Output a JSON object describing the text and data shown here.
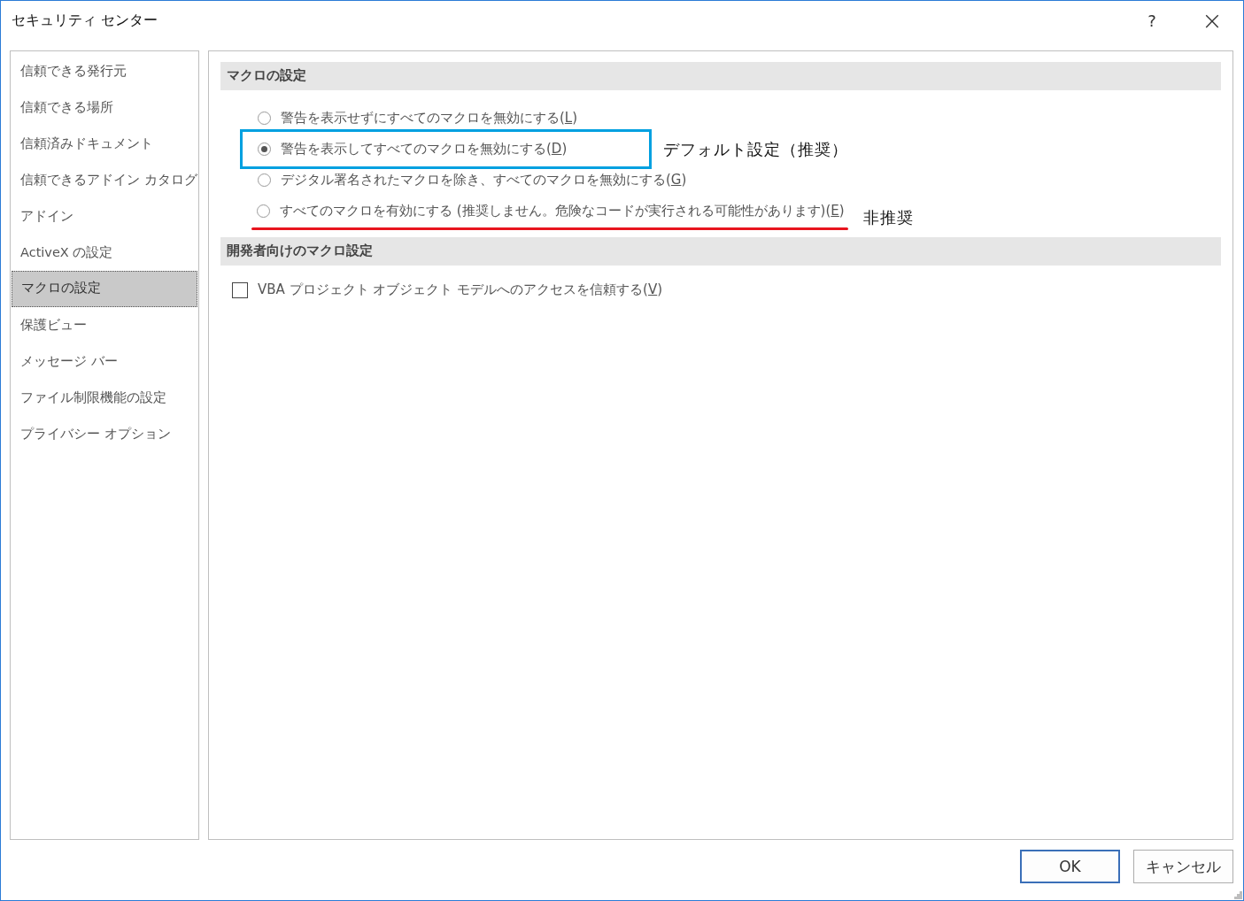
{
  "window": {
    "title": "セキュリティ センター",
    "help": "?",
    "close": "×"
  },
  "sidebar": {
    "items": [
      {
        "label": "信頼できる発行元",
        "selected": false
      },
      {
        "label": "信頼できる場所",
        "selected": false
      },
      {
        "label": "信頼済みドキュメント",
        "selected": false
      },
      {
        "label": "信頼できるアドイン カタログ",
        "selected": false
      },
      {
        "label": "アドイン",
        "selected": false
      },
      {
        "label": "ActiveX の設定",
        "selected": false
      },
      {
        "label": "マクロの設定",
        "selected": true
      },
      {
        "label": "保護ビュー",
        "selected": false
      },
      {
        "label": "メッセージ バー",
        "selected": false
      },
      {
        "label": "ファイル制限機能の設定",
        "selected": false
      },
      {
        "label": "プライバシー オプション",
        "selected": false
      }
    ]
  },
  "sections": [
    {
      "title": "マクロの設定",
      "kind": "radios",
      "options": [
        {
          "label": "警告を表示せずにすべてのマクロを無効にする(",
          "access_key": "L",
          "label_end": ")",
          "selected": false
        },
        {
          "label": "警告を表示してすべてのマクロを無効にする(",
          "access_key": "D",
          "label_end": ")",
          "selected": true,
          "annotation": {
            "kind": "box",
            "color": "#00a0e0",
            "text": "デフォルト設定（推奨）"
          }
        },
        {
          "label": "デジタル署名されたマクロを除き、すべてのマクロを無効にする(",
          "access_key": "G",
          "label_end": ")",
          "selected": false
        },
        {
          "label": "すべてのマクロを有効にする (推奨しません。危険なコードが実行される可能性があります)(",
          "access_key": "E",
          "label_end": ")",
          "selected": false,
          "annotation": {
            "kind": "underline",
            "color": "#e8141e",
            "text": "非推奨"
          }
        }
      ]
    },
    {
      "title": "開発者向けのマクロ設定",
      "kind": "checkboxes",
      "options": [
        {
          "label": "VBA プロジェクト オブジェクト モデルへのアクセスを信頼する(",
          "access_key": "V",
          "label_end": ")",
          "checked": false
        }
      ]
    }
  ],
  "buttons": [
    {
      "label": "OK",
      "default": true
    },
    {
      "label": "キャンセル",
      "default": false
    }
  ]
}
